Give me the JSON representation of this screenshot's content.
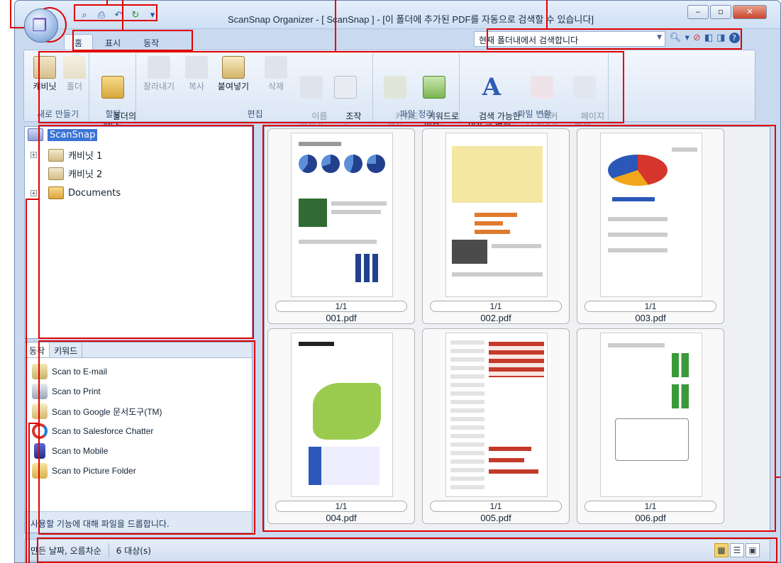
{
  "window": {
    "title": "ScanSnap Organizer - [ ScanSnap ] - [이 폴더에 추가된 PDF를 자동으로 검색할 수 있습니다]",
    "controls": [
      "‒",
      "▫",
      "✕"
    ]
  },
  "qat": {
    "items": [
      "search-doc-icon",
      "print-icon",
      "undo-icon",
      "refresh-icon"
    ],
    "more": "▾"
  },
  "tabs": [
    "홈",
    "표시",
    "동작"
  ],
  "search": {
    "value": "현재 폴더내에서 검색합니다"
  },
  "ribbon": {
    "groups": [
      {
        "label": "새로 만들기",
        "buttons": [
          {
            "label": "캐비닛",
            "enabled": true
          },
          {
            "label": "폴더",
            "enabled": false
          }
        ]
      },
      {
        "label": "할당",
        "buttons": [
          {
            "label": "폴더의\n할당▾",
            "enabled": true
          }
        ]
      },
      {
        "label": "편집",
        "buttons": [
          {
            "label": "잘라내기",
            "enabled": false
          },
          {
            "label": "복사",
            "enabled": false
          },
          {
            "label": "붙여넣기",
            "enabled": true
          },
          {
            "label": "삭제",
            "enabled": false
          },
          {
            "label": "이름\n바꾸기",
            "enabled": false
          },
          {
            "label": "조작\n▾",
            "enabled": true
          }
        ]
      },
      {
        "label": "파일 정리",
        "buttons": [
          {
            "label": "키워드\n편집",
            "enabled": false
          },
          {
            "label": "키워드로\n배분▾",
            "enabled": true
          }
        ]
      },
      {
        "label": "파일 변환",
        "buttons": [
          {
            "label": "검색 가능한\nPDF로 변환▾",
            "enabled": true
          },
          {
            "label": "마커\n오려내기",
            "enabled": false
          },
          {
            "label": "페이지\n병합▾",
            "enabled": false
          }
        ]
      }
    ]
  },
  "tree": {
    "items": [
      {
        "label": "ScanSnap",
        "selected": true
      },
      {
        "label": "캐비닛 1",
        "expandable": true
      },
      {
        "label": "캐비닛 2",
        "expandable": false
      },
      {
        "label": "Documents",
        "expandable": true
      }
    ]
  },
  "actions": {
    "tabs": [
      "동작",
      "키워드"
    ],
    "items": [
      "Scan to E-mail",
      "Scan to Print",
      "Scan to Google 문서도구(TM)",
      "Scan to Salesforce Chatter",
      "Scan to Mobile",
      "Scan to Picture Folder"
    ],
    "footer": "사용할 기능에 대해 파일을 드롭합니다."
  },
  "files": [
    {
      "name": "001.pdf",
      "pages": "1/1"
    },
    {
      "name": "002.pdf",
      "pages": "1/1"
    },
    {
      "name": "003.pdf",
      "pages": "1/1"
    },
    {
      "name": "004.pdf",
      "pages": "1/1"
    },
    {
      "name": "005.pdf",
      "pages": "1/1"
    },
    {
      "name": "006.pdf",
      "pages": "1/1"
    }
  ],
  "status": {
    "sort": "만든 날짜, 오름차순",
    "count": "6 대상(s)"
  },
  "colors": {
    "accent": "#3b74d6",
    "annotation": "#e00000",
    "ribbon": "#dbe6f5"
  }
}
